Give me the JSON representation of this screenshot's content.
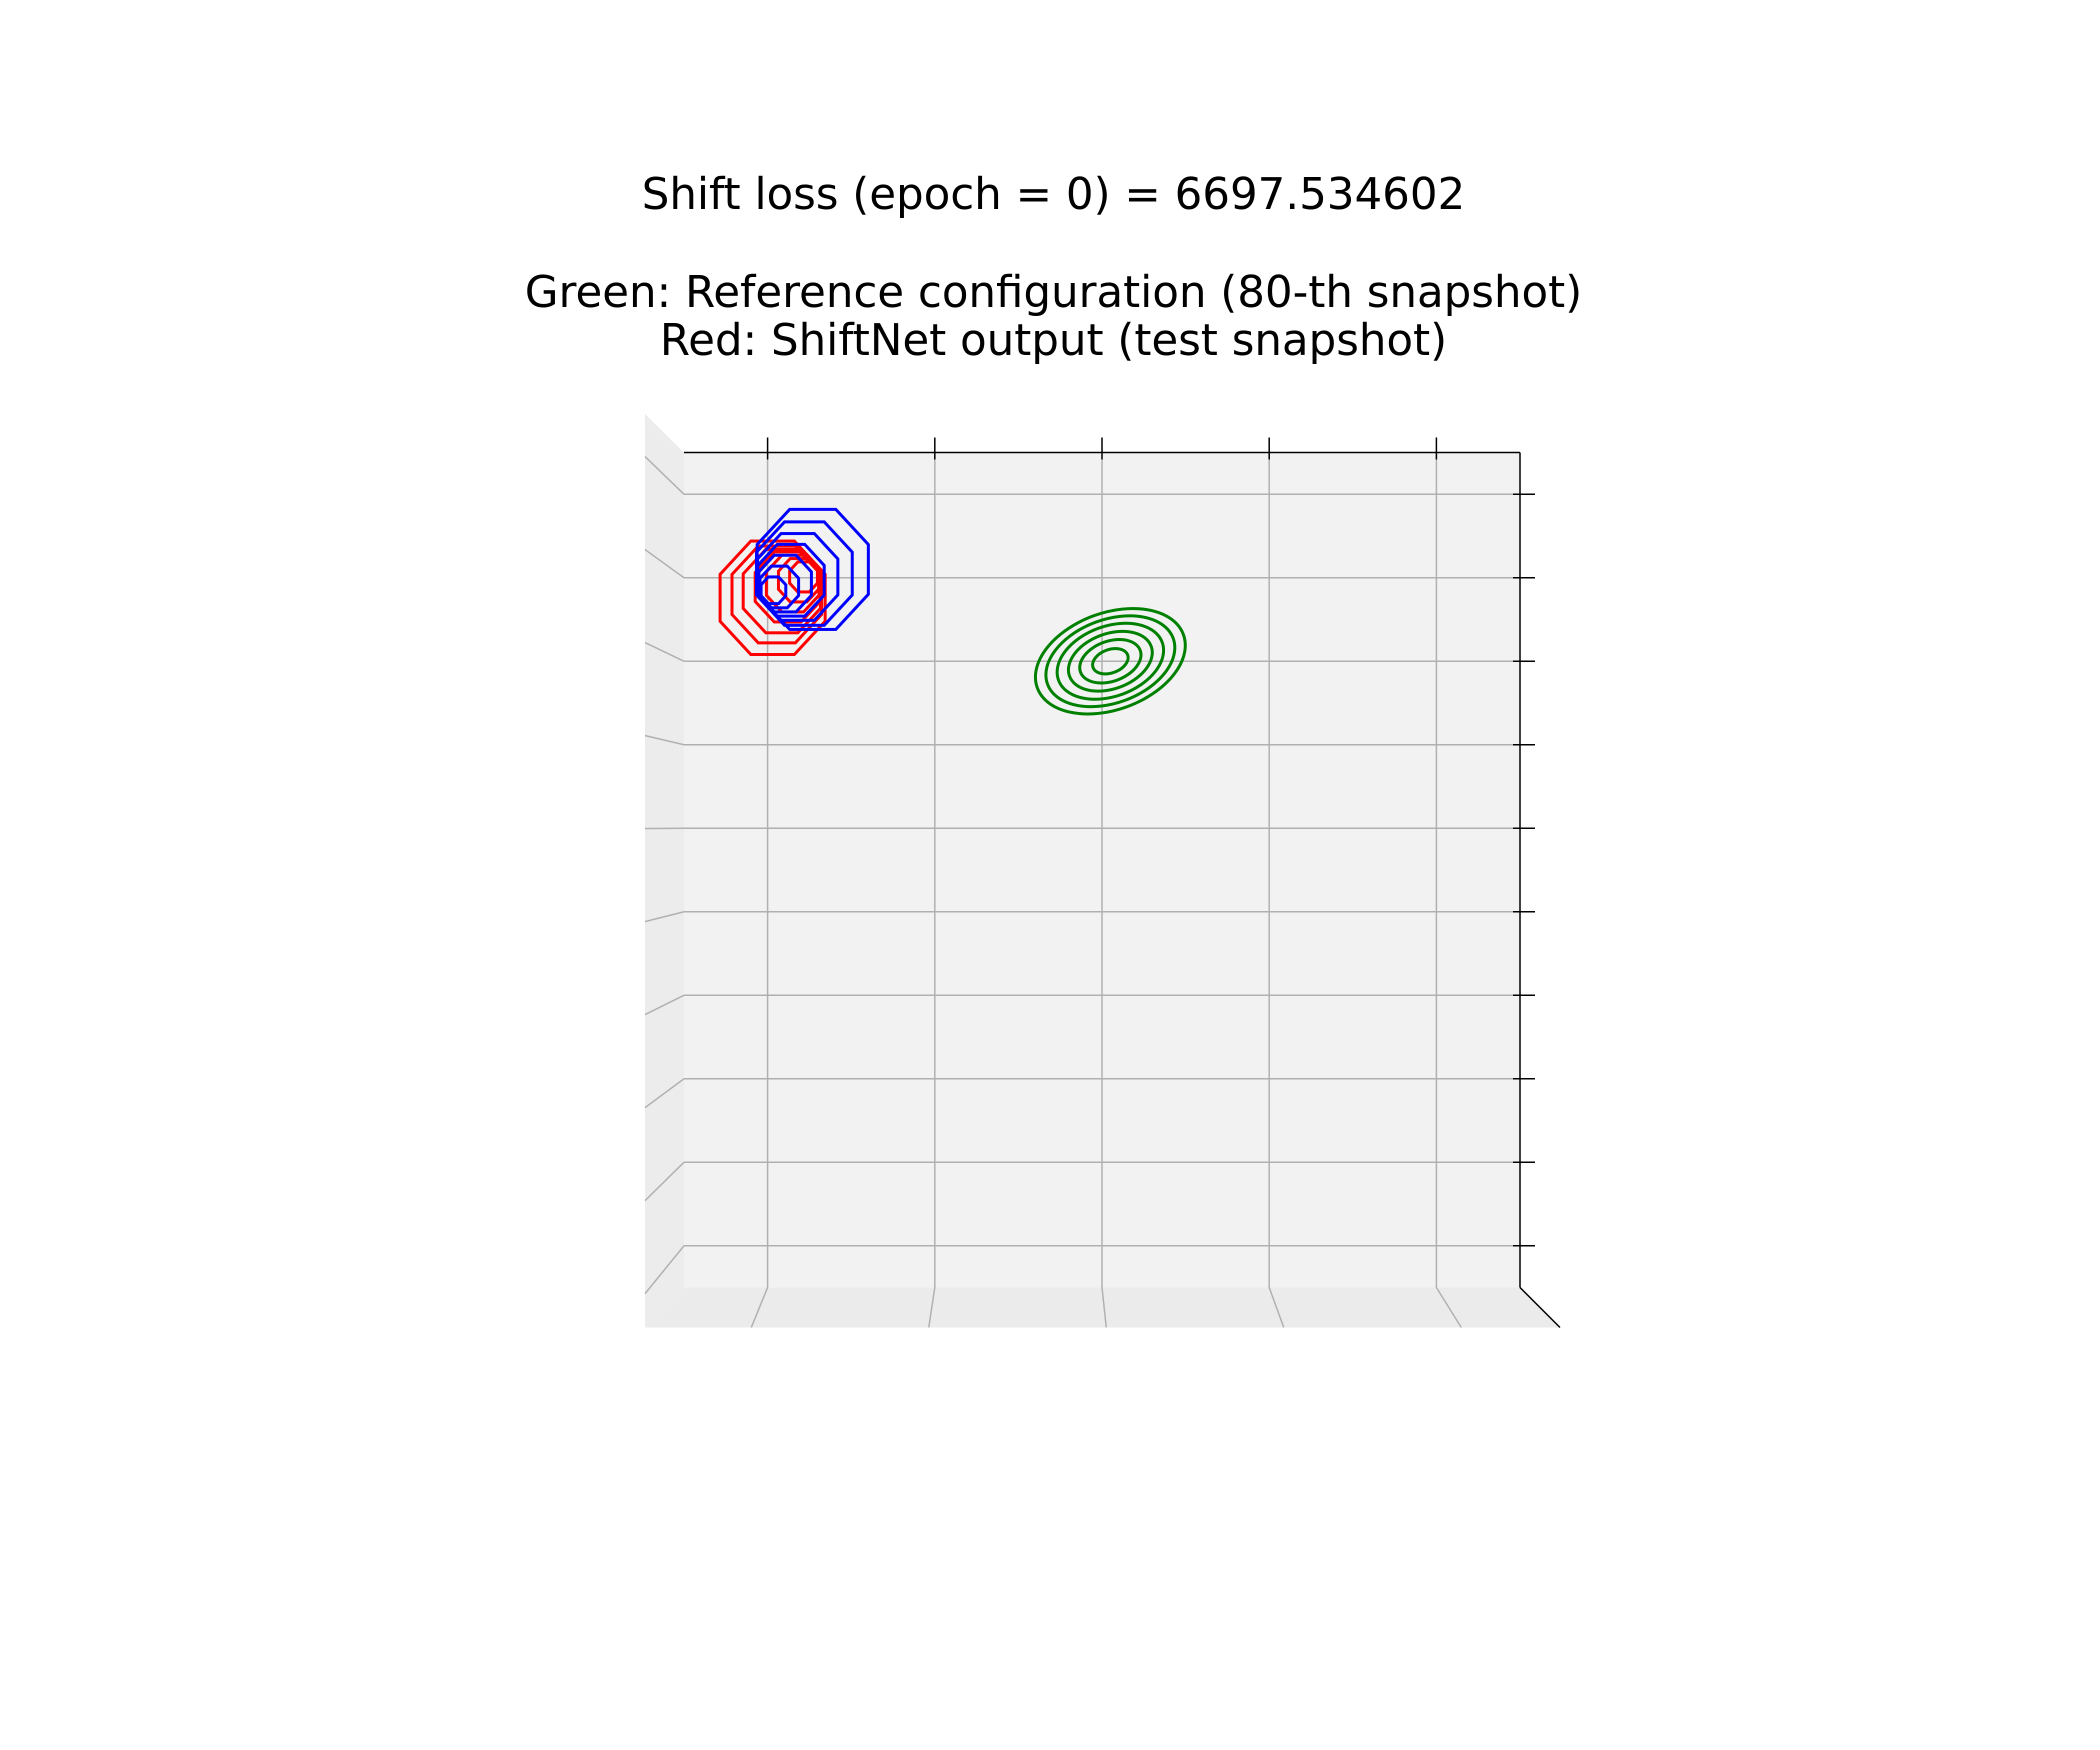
{
  "chart_data": {
    "type": "contour",
    "title_lines": [
      "Shift loss (epoch = 0) = 6697.534602",
      "",
      "Green: Reference configuration (80-th snapshot)",
      "Red: ShiftNet output (test snapshot)"
    ],
    "xlabel": "",
    "ylabel": "",
    "xlim": [
      0,
      1
    ],
    "ylim": [
      0,
      1
    ],
    "grid": true,
    "projection": "3d-top-view",
    "tick_labels_visible": false,
    "x_ticks": [
      0.1,
      0.3,
      0.5,
      0.7,
      0.9
    ],
    "y_ticks": [
      0.05,
      0.15,
      0.25,
      0.35,
      0.45,
      0.55,
      0.65,
      0.75,
      0.85,
      0.95
    ],
    "series": [
      {
        "name": "Reference configuration (80-th snapshot)",
        "color": "#008000",
        "style": "ellipse",
        "center": [
          0.51,
          0.75
        ],
        "rx": [
          0.093,
          0.08,
          0.066,
          0.052,
          0.038,
          0.022
        ],
        "ry": [
          0.058,
          0.05,
          0.042,
          0.033,
          0.024,
          0.014
        ],
        "rotation_deg": -20
      },
      {
        "name": "ShiftNet output (test snapshot)",
        "color": "#ff0000",
        "style": "octagon",
        "center": [
          0.106,
          0.826
        ],
        "centers": [
          [
            0.106,
            0.826
          ],
          [
            0.111,
            0.83
          ],
          [
            0.117,
            0.834
          ],
          [
            0.124,
            0.839
          ],
          [
            0.13,
            0.843
          ],
          [
            0.137,
            0.847
          ],
          [
            0.143,
            0.851
          ]
        ],
        "r": [
          0.068,
          0.058,
          0.05,
          0.042,
          0.034,
          0.026,
          0.018
        ],
        "sy": 1.08
      },
      {
        "name": "",
        "color": "#0000ff",
        "style": "octagon",
        "centers": [
          [
            0.154,
            0.86
          ],
          [
            0.144,
            0.855
          ],
          [
            0.136,
            0.851
          ],
          [
            0.128,
            0.847
          ],
          [
            0.121,
            0.843
          ],
          [
            0.114,
            0.839
          ],
          [
            0.107,
            0.835
          ]
        ],
        "r": [
          0.072,
          0.062,
          0.052,
          0.043,
          0.034,
          0.025,
          0.016
        ],
        "sy": 1.08
      }
    ]
  }
}
